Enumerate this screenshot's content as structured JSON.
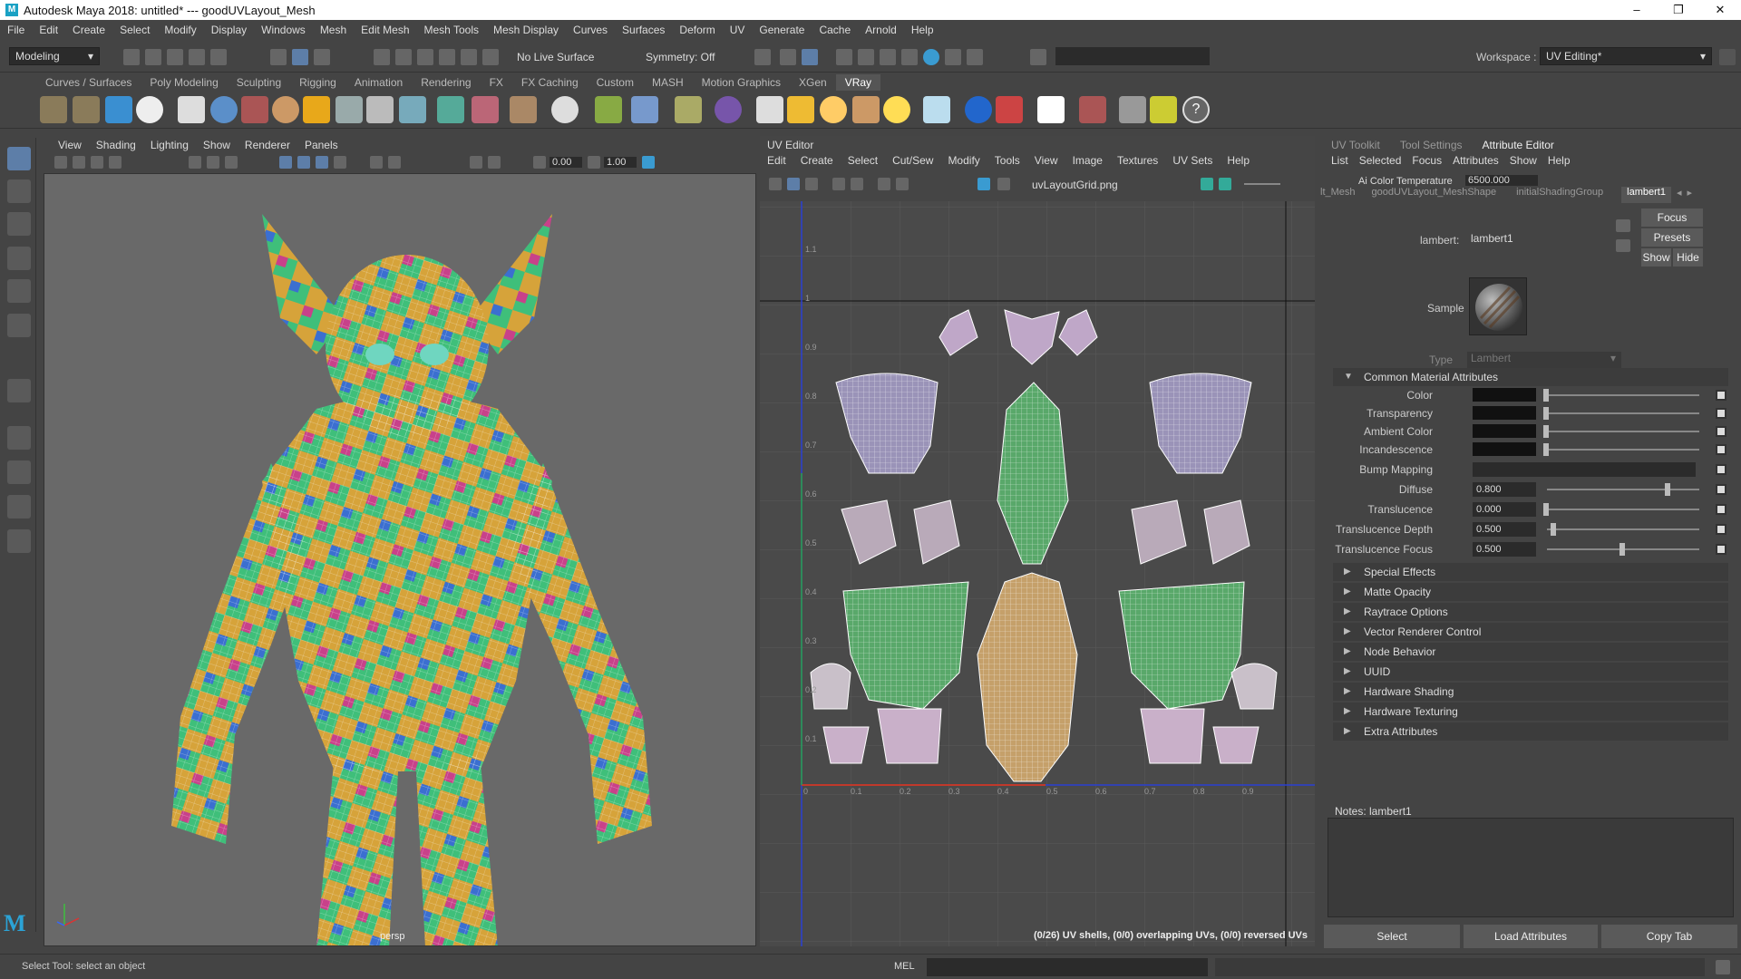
{
  "window": {
    "title": "Autodesk Maya 2018: untitled*   ---   goodUVLayout_Mesh",
    "logo": "M",
    "minimize": "–",
    "maximize": "❐",
    "close": "✕"
  },
  "menubar": [
    "File",
    "Edit",
    "Create",
    "Select",
    "Modify",
    "Display",
    "Windows",
    "Mesh",
    "Edit Mesh",
    "Mesh Tools",
    "Mesh Display",
    "Curves",
    "Surfaces",
    "Deform",
    "UV",
    "Generate",
    "Cache",
    "Arnold",
    "Help"
  ],
  "statusline": {
    "mode": "Modeling",
    "live_surface": "No Live Surface",
    "symmetry": "Symmetry: Off",
    "workspace_label": "Workspace :",
    "workspace_value": "UV Editing*"
  },
  "shelf_tabs": [
    "Curves / Surfaces",
    "Poly Modeling",
    "Sculpting",
    "Rigging",
    "Animation",
    "Rendering",
    "FX",
    "FX Caching",
    "Custom",
    "MASH",
    "Motion Graphics",
    "XGen",
    "VRay"
  ],
  "shelf_active": "VRay",
  "viewport": {
    "menu": [
      "View",
      "Shading",
      "Lighting",
      "Show",
      "Renderer",
      "Panels"
    ],
    "value1": "0.00",
    "value2": "1.00",
    "camera_label": "persp"
  },
  "uv_editor": {
    "title": "UV Editor",
    "menu": [
      "Edit",
      "Create",
      "Select",
      "Cut/Sew",
      "Modify",
      "Tools",
      "View",
      "Image",
      "Textures",
      "UV Sets",
      "Help"
    ],
    "texture": "uvLayoutGrid.png",
    "status": "(0/26) UV shells, (0/0) overlapping UVs, (0/0) reversed UVs",
    "axis_labels_x": [
      "0",
      "0.1",
      "0.2",
      "0.3",
      "0.4",
      "0.5",
      "0.6",
      "0.7",
      "0.8",
      "0.9"
    ],
    "axis_labels_y": [
      "1.1",
      "1",
      "0.9",
      "0.8",
      "0.7",
      "0.6",
      "0.5",
      "0.4",
      "0.3",
      "0.2",
      "0.1"
    ]
  },
  "attribute_editor": {
    "tabs": [
      "UV Toolkit",
      "Tool Settings",
      "Attribute Editor"
    ],
    "active_tab": "Attribute Editor",
    "menu": [
      "List",
      "Selected",
      "Focus",
      "Attributes",
      "Show",
      "Help"
    ],
    "color_temp_label": "Ai Color Temperature",
    "color_temp_value": "6500.000",
    "node_tabs": [
      "lt_Mesh",
      "goodUVLayout_MeshShape",
      "initialShadingGroup",
      "lambert1"
    ],
    "node_label": "lambert:",
    "node_value": "lambert1",
    "focus": "Focus",
    "presets": "Presets",
    "show": "Show",
    "hide": "Hide",
    "sample_label": "Sample",
    "type_label": "Type",
    "type_value": "Lambert",
    "common_section": "Common Material Attributes",
    "attrs": [
      {
        "label": "Color",
        "kind": "swatch"
      },
      {
        "label": "Transparency",
        "kind": "swatch"
      },
      {
        "label": "Ambient Color",
        "kind": "swatch"
      },
      {
        "label": "Incandescence",
        "kind": "swatch"
      },
      {
        "label": "Bump Mapping",
        "kind": "empty"
      },
      {
        "label": "Diffuse",
        "kind": "value",
        "value": "0.800",
        "fraction": 0.8
      },
      {
        "label": "Translucence",
        "kind": "value",
        "value": "0.000",
        "fraction": 0.0
      },
      {
        "label": "Translucence Depth",
        "kind": "value",
        "value": "0.500",
        "fraction": 0.05
      },
      {
        "label": "Translucence Focus",
        "kind": "value",
        "value": "0.500",
        "fraction": 0.5
      }
    ],
    "sections": [
      "Special Effects",
      "Matte Opacity",
      "Raytrace Options",
      "Vector Renderer Control",
      "Node Behavior",
      "UUID",
      "Hardware Shading",
      "Hardware Texturing",
      "Extra Attributes"
    ],
    "notes_label": "Notes:  lambert1",
    "buttons": [
      "Select",
      "Load Attributes",
      "Copy Tab"
    ]
  },
  "bottom": {
    "help_line": "Select Tool: select an object",
    "mel": "MEL"
  },
  "colors": {
    "accent": "#1aa1c4",
    "uv_grid_x": "#c0392b",
    "uv_grid_y": "#2a3fd1"
  }
}
